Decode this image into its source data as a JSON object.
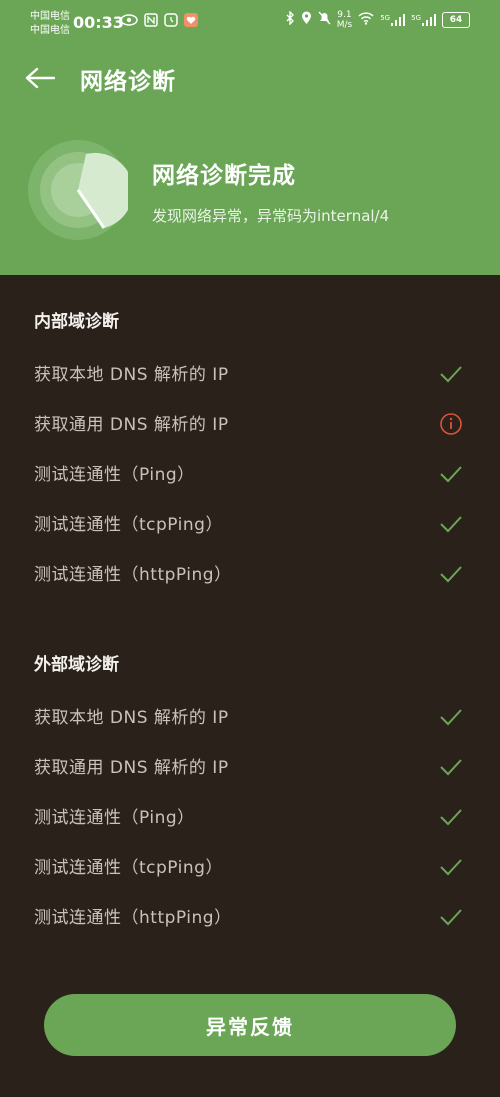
{
  "status": {
    "carrier1": "中国电信",
    "carrier2": "中国电信",
    "time": "00:33",
    "speed_value": "9.1",
    "speed_unit": "M/s",
    "net1": "5G",
    "net2": "5G",
    "battery": "64"
  },
  "header": {
    "title": "网络诊断"
  },
  "summary": {
    "title": "网络诊断完成",
    "subtitle": "发现网络异常，异常码为internal/4"
  },
  "sections": [
    {
      "title": "内部域诊断",
      "items": [
        {
          "label": "获取本地 DNS 解析的 IP",
          "status": "ok"
        },
        {
          "label": "获取通用 DNS 解析的 IP",
          "status": "error"
        },
        {
          "label": "测试连通性（Ping）",
          "status": "ok"
        },
        {
          "label": "测试连通性（tcpPing）",
          "status": "ok"
        },
        {
          "label": "测试连通性（httpPing）",
          "status": "ok"
        }
      ]
    },
    {
      "title": "外部域诊断",
      "items": [
        {
          "label": "获取本地 DNS 解析的 IP",
          "status": "ok"
        },
        {
          "label": "获取通用 DNS 解析的 IP",
          "status": "ok"
        },
        {
          "label": "测试连通性（Ping）",
          "status": "ok"
        },
        {
          "label": "测试连通性（tcpPing）",
          "status": "ok"
        },
        {
          "label": "测试连通性（httpPing）",
          "status": "ok"
        }
      ]
    }
  ],
  "feedback_label": "异常反馈",
  "colors": {
    "accent": "#6aa656",
    "background": "#2a211b",
    "ok": "#6aa656",
    "error": "#d9533b"
  }
}
